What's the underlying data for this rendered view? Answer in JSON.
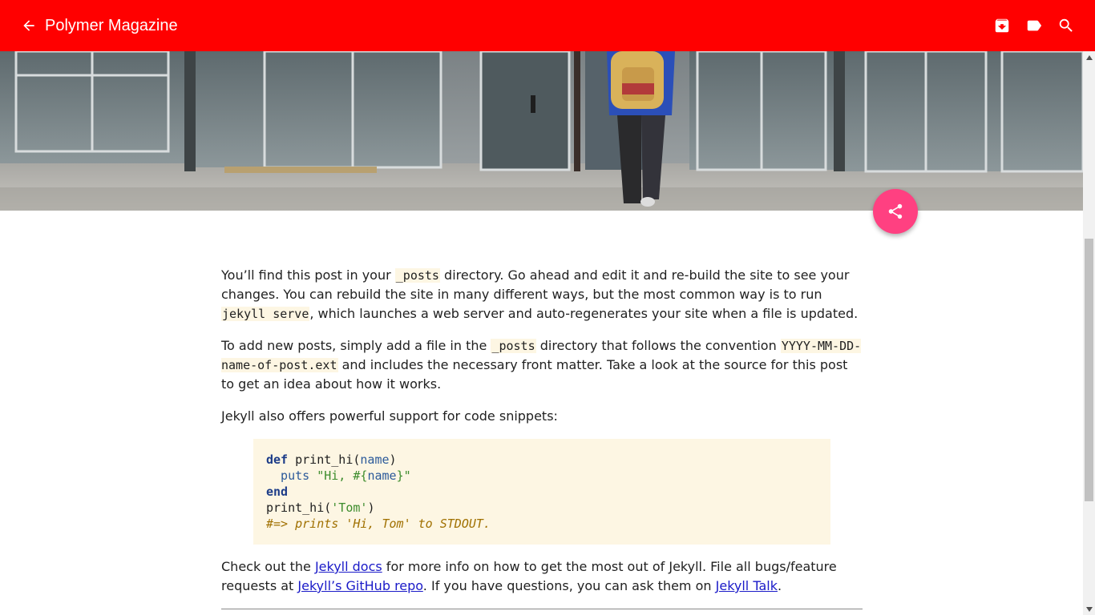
{
  "appbar": {
    "title": "Polymer Magazine",
    "background": "#ff0000",
    "icons": [
      "arrow-back-icon",
      "archive-icon",
      "label-icon",
      "search-icon"
    ]
  },
  "fab": {
    "icon": "share-icon",
    "color": "#ff4081"
  },
  "paragraphs": {
    "p1": {
      "t1": "You’ll find this post in your ",
      "c1": "_posts",
      "t2": " directory. Go ahead and edit it and re-build the site to see your changes. You can rebuild the site in many different ways, but the most common way is to run ",
      "c2": "jekyll serve",
      "t3": ", which launches a web server and auto-regenerates your site when a file is updated."
    },
    "p2": {
      "t1": "To add new posts, simply add a file in the ",
      "c1": "_posts",
      "t2": " directory that follows the convention ",
      "c2": "YYYY-MM-DD-name-of-post.ext",
      "t3": " and includes the necessary front matter. Take a look at the source for this post to get an idea about how it works."
    },
    "p3": {
      "t1": "Jekyll also offers powerful support for code snippets:"
    },
    "p4": {
      "t1": "Check out the ",
      "l1": "Jekyll docs",
      "t2": " for more info on how to get the most out of Jekyll. File all bugs/feature requests at ",
      "l2": "Jekyll’s GitHub repo",
      "t3": ". If you have questions, you can ask them on ",
      "l3": "Jekyll Talk",
      "t4": "."
    }
  },
  "code": {
    "l1_kw": "def",
    "l1_fn": " print_hi(",
    "l1_arg": "name",
    "l1_end": ")",
    "l2_fn": "  puts ",
    "l2_str1": "\"Hi, #{",
    "l2_var": "name",
    "l2_str2": "}\"",
    "l3_kw": "end",
    "l4_fn": "print_hi(",
    "l4_str": "'Tom'",
    "l4_end": ")",
    "l5_cmt": "#=> prints 'Hi, Tom' to STDOUT."
  }
}
